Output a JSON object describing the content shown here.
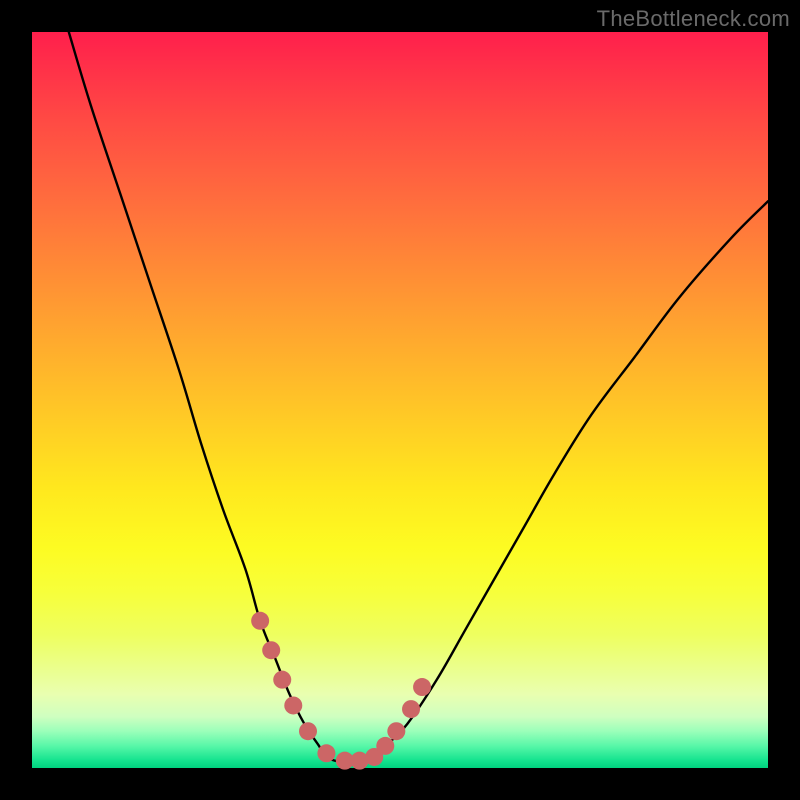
{
  "watermark": "TheBottleneck.com",
  "chart_data": {
    "type": "line",
    "title": "",
    "xlabel": "",
    "ylabel": "",
    "xlim": [
      0,
      100
    ],
    "ylim": [
      0,
      100
    ],
    "grid": false,
    "legend": false,
    "annotations": [],
    "series": [
      {
        "name": "bottleneck-curve",
        "color": "#000000",
        "x": [
          5,
          8,
          12,
          16,
          20,
          23,
          26,
          29,
          31,
          33,
          35,
          37,
          39,
          40,
          42,
          44,
          46,
          48,
          51,
          55,
          59,
          63,
          67,
          71,
          76,
          82,
          88,
          95,
          100
        ],
        "y": [
          100,
          90,
          78,
          66,
          54,
          44,
          35,
          27,
          20,
          15,
          10,
          6,
          3,
          1.5,
          0.8,
          0.8,
          1.5,
          3,
          6,
          12,
          19,
          26,
          33,
          40,
          48,
          56,
          64,
          72,
          77
        ]
      },
      {
        "name": "highlight-markers",
        "color": "#cc6666",
        "type": "scatter",
        "x": [
          31,
          32.5,
          34,
          35.5,
          37.5,
          40,
          42.5,
          44.5,
          46.5,
          48,
          49.5,
          51.5,
          53
        ],
        "y": [
          20,
          16,
          12,
          8.5,
          5,
          2,
          1,
          1,
          1.5,
          3,
          5,
          8,
          11
        ]
      }
    ],
    "background_gradient": {
      "stops": [
        {
          "pos": 0,
          "color": "#ff1f4c"
        },
        {
          "pos": 50,
          "color": "#ffd525"
        },
        {
          "pos": 75,
          "color": "#f7ff3a"
        },
        {
          "pos": 100,
          "color": "#00d27f"
        }
      ]
    }
  }
}
